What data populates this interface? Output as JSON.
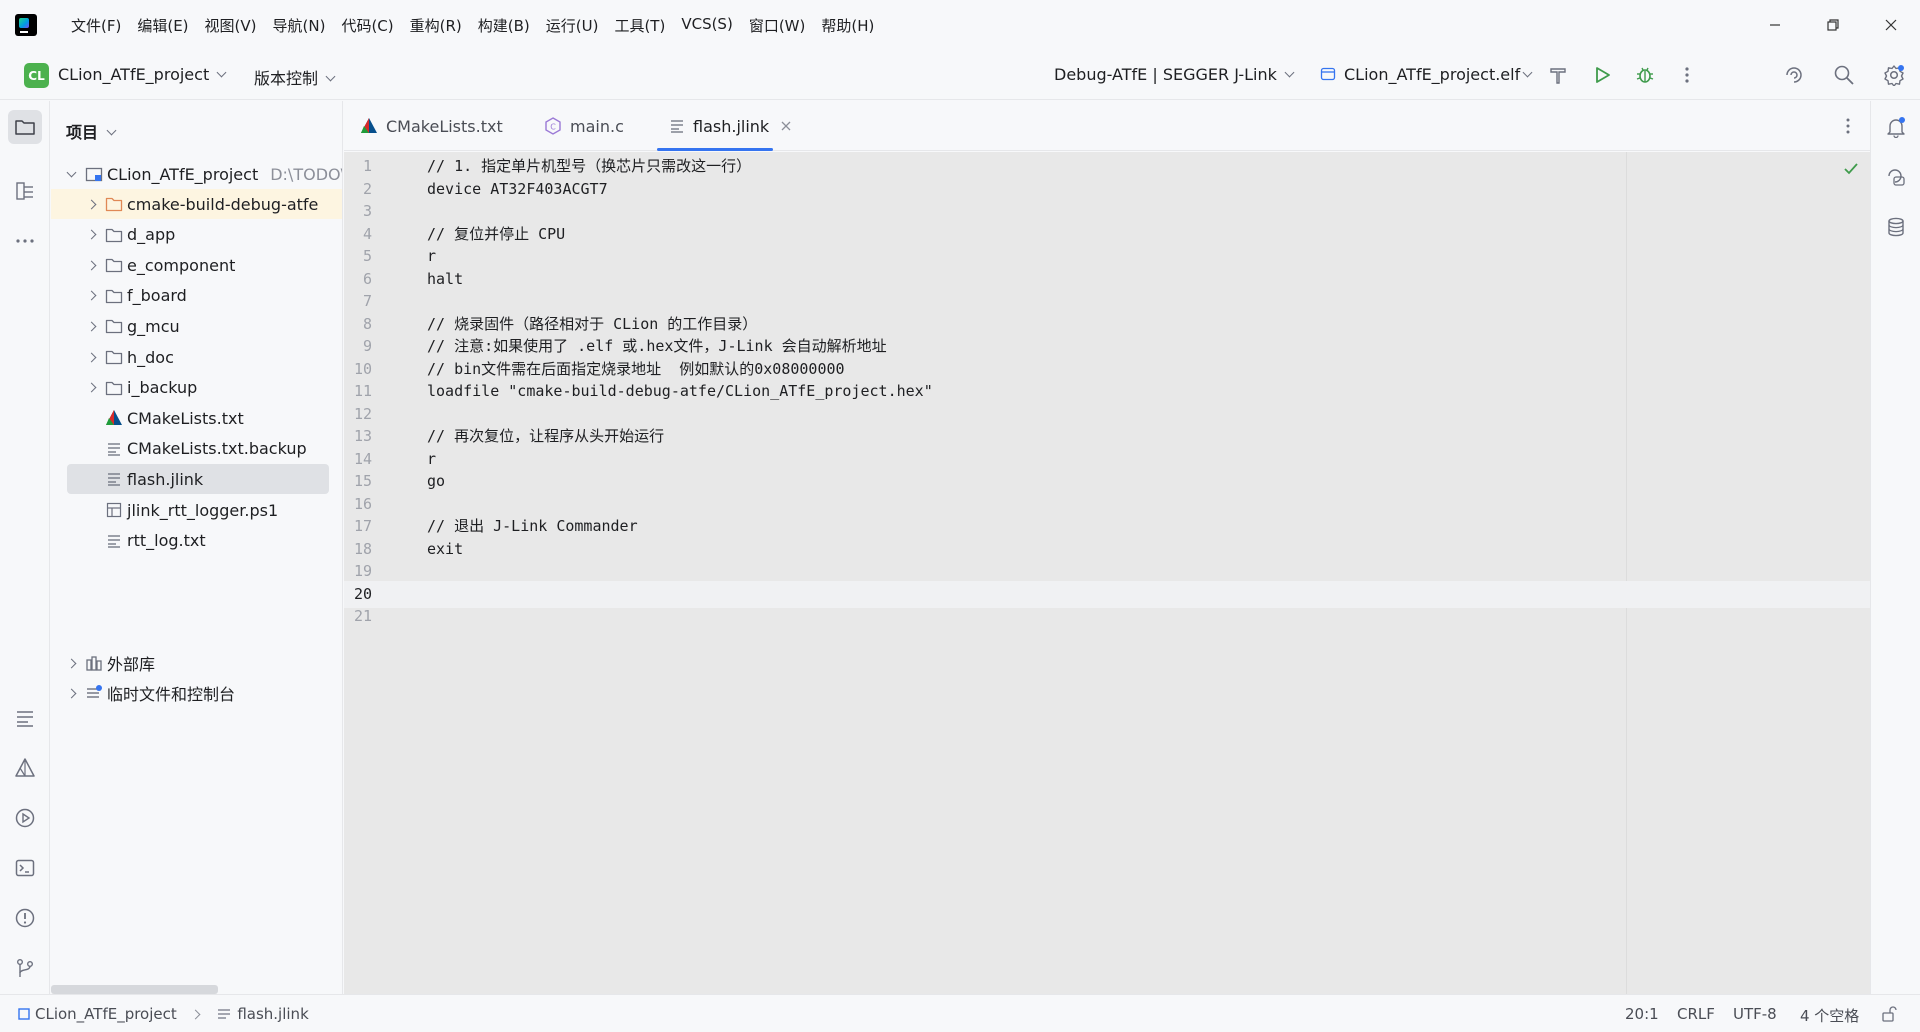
{
  "menu": [
    "文件(F)",
    "编辑(E)",
    "视图(V)",
    "导航(N)",
    "代码(C)",
    "重构(R)",
    "构建(B)",
    "运行(U)",
    "工具(T)",
    "VCS(S)",
    "窗口(W)",
    "帮助(H)"
  ],
  "toolbar": {
    "project_badge": "CL",
    "project_name": "CLion_ATfE_project",
    "vcs_label": "版本控制",
    "run_config": "Debug-ATfE | SEGGER J-Link",
    "target": "CLion_ATfE_project.elf"
  },
  "project_panel": {
    "title": "项目",
    "root_name": "CLion_ATfE_project",
    "root_path": "D:\\TODO\\(",
    "items": [
      {
        "label": "cmake-build-debug-atfe",
        "kind": "folder-orange"
      },
      {
        "label": "d_app",
        "kind": "folder"
      },
      {
        "label": "e_component",
        "kind": "folder"
      },
      {
        "label": "f_board",
        "kind": "folder"
      },
      {
        "label": "g_mcu",
        "kind": "folder"
      },
      {
        "label": "h_doc",
        "kind": "folder"
      },
      {
        "label": "i_backup",
        "kind": "folder"
      },
      {
        "label": "CMakeLists.txt",
        "kind": "cmake"
      },
      {
        "label": "CMakeLists.txt.backup",
        "kind": "text"
      },
      {
        "label": "flash.jlink",
        "kind": "text"
      },
      {
        "label": "jlink_rtt_logger.ps1",
        "kind": "ps1"
      },
      {
        "label": "rtt_log.txt",
        "kind": "text"
      }
    ],
    "external_libs": "外部库",
    "scratches": "临时文件和控制台"
  },
  "tabs": [
    {
      "label": "CMakeLists.txt",
      "icon": "cmake-icon"
    },
    {
      "label": "main.c",
      "icon": "c-file-icon"
    },
    {
      "label": "flash.jlink",
      "icon": "text-file-icon",
      "active": true
    }
  ],
  "editor": {
    "current_line": 20,
    "lines": [
      "// 1. 指定单片机型号（换芯片只需改这一行）",
      "device AT32F403ACGT7",
      "",
      "// 复位并停止 CPU",
      "r",
      "halt",
      "",
      "// 烧录固件（路径相对于 CLion 的工作目录）",
      "// 注意:如果使用了 .elf 或.hex文件，J-Link 会自动解析地址",
      "// bin文件需在后面指定烧录地址  例如默认的0x08000000",
      "loadfile \"cmake-build-debug-atfe/CLion_ATfE_project.hex\"",
      "",
      "// 再次复位，让程序从头开始运行",
      "r",
      "go",
      "",
      "// 退出 J-Link Commander",
      "exit",
      "",
      "",
      ""
    ]
  },
  "statusbar": {
    "crumb_project": "CLion_ATfE_project",
    "crumb_file": "flash.jlink",
    "position": "20:1",
    "line_sep": "CRLF",
    "encoding": "UTF-8",
    "indent": "4 个空格"
  },
  "colors": {
    "accent": "#3574f0",
    "run": "#3f9b4c",
    "badge": "#4cb14e",
    "folder_highlight": "#fdf5e1"
  }
}
